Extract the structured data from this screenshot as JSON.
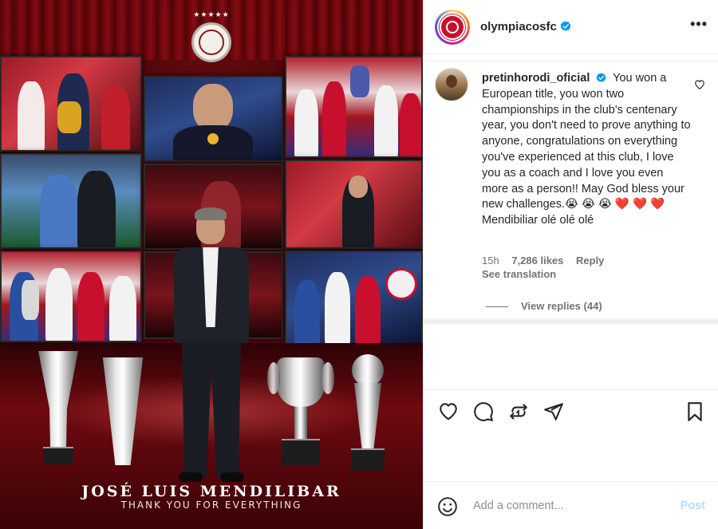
{
  "post_image": {
    "caption_name": "JOSÉ LUIS MENDILIBAR",
    "caption_thanks": "THANK YOU FOR EVERYTHING",
    "crest_stars": "★★★★★"
  },
  "header": {
    "username": "olympiacosfc",
    "verified_icon": "verified-badge-icon",
    "more_icon": "more-options-icon",
    "more_glyph": "•••"
  },
  "comment": {
    "username": "pretinhorodi_oficial",
    "text": "You won a European title, you won two championships in the club's centenary year, you don't need to prove anything to anyone, congratulations on everything you've experienced at this club, I love you as a coach and I love you even more as a person!! May God bless your new challenges.😭 😭 😭 ❤️ ❤️ ❤️  Mendibiliar olé olé olé",
    "time": "15h",
    "likes": "7,286 likes",
    "reply": "Reply",
    "see_translation": "See translation",
    "view_replies": "View replies (44)"
  },
  "actions": {
    "like_icon": "heart-icon",
    "comment_icon": "comment-icon",
    "repost_icon": "repost-icon",
    "share_icon": "share-icon",
    "save_icon": "bookmark-icon"
  },
  "add_comment": {
    "placeholder": "Add a comment...",
    "post_label": "Post",
    "emoji_icon": "emoji-icon"
  },
  "colors": {
    "accent_blue": "#0095f6",
    "post_disabled": "#b2dffc",
    "verified": "#0095f6",
    "text": "#262626",
    "muted": "#737373"
  }
}
